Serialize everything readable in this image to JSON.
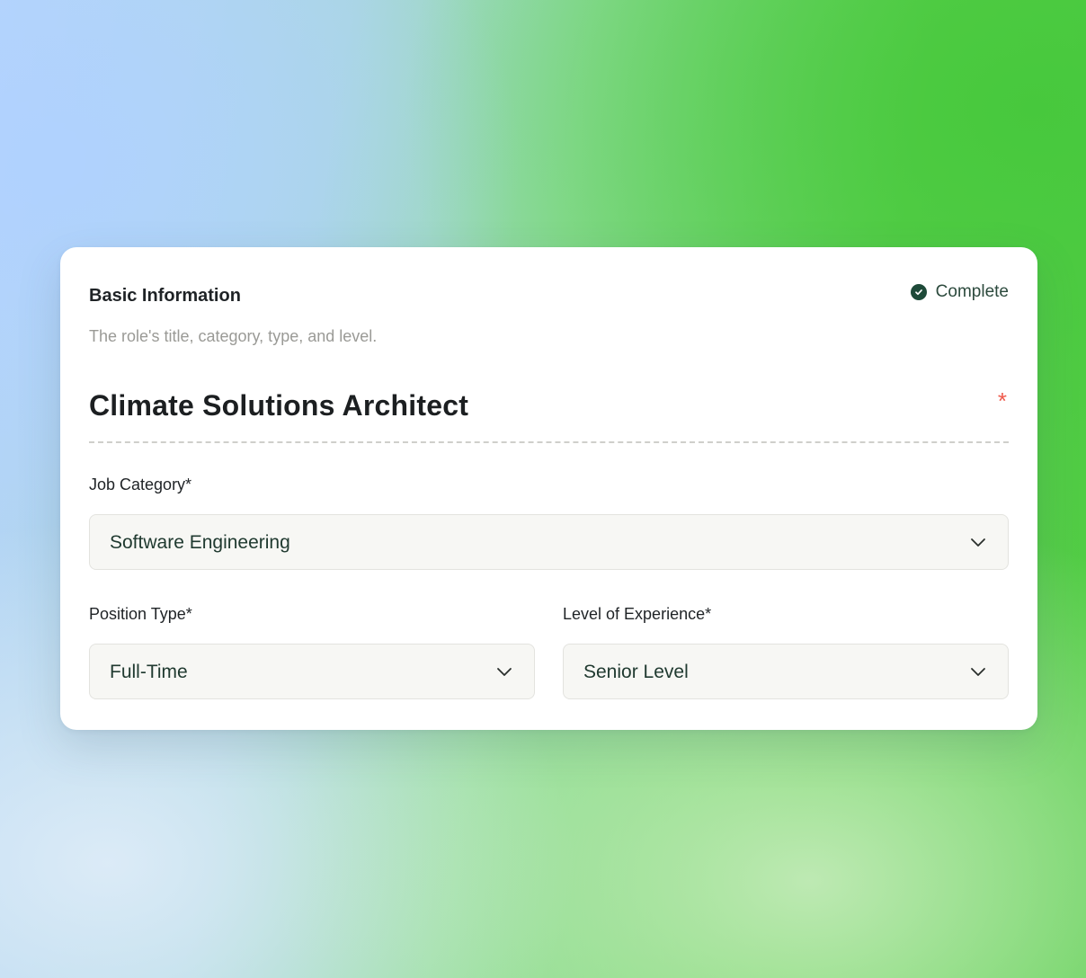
{
  "section": {
    "title": "Basic Information",
    "description": "The role's title, category, type, and level.",
    "status": "Complete"
  },
  "job_title": {
    "value": "Climate Solutions Architect",
    "required_mark": "*"
  },
  "fields": {
    "job_category": {
      "label": "Job Category*",
      "value": "Software Engineering"
    },
    "position_type": {
      "label": "Position Type*",
      "value": "Full-Time"
    },
    "experience_level": {
      "label": "Level of Experience*",
      "value": "Senior Level"
    }
  },
  "colors": {
    "status_icon": "#1e4a39",
    "required": "#ef5a4c",
    "select_bg": "#f7f7f4"
  },
  "icons": {
    "status": "check-circle-icon",
    "dropdown": "chevron-down-icon"
  }
}
